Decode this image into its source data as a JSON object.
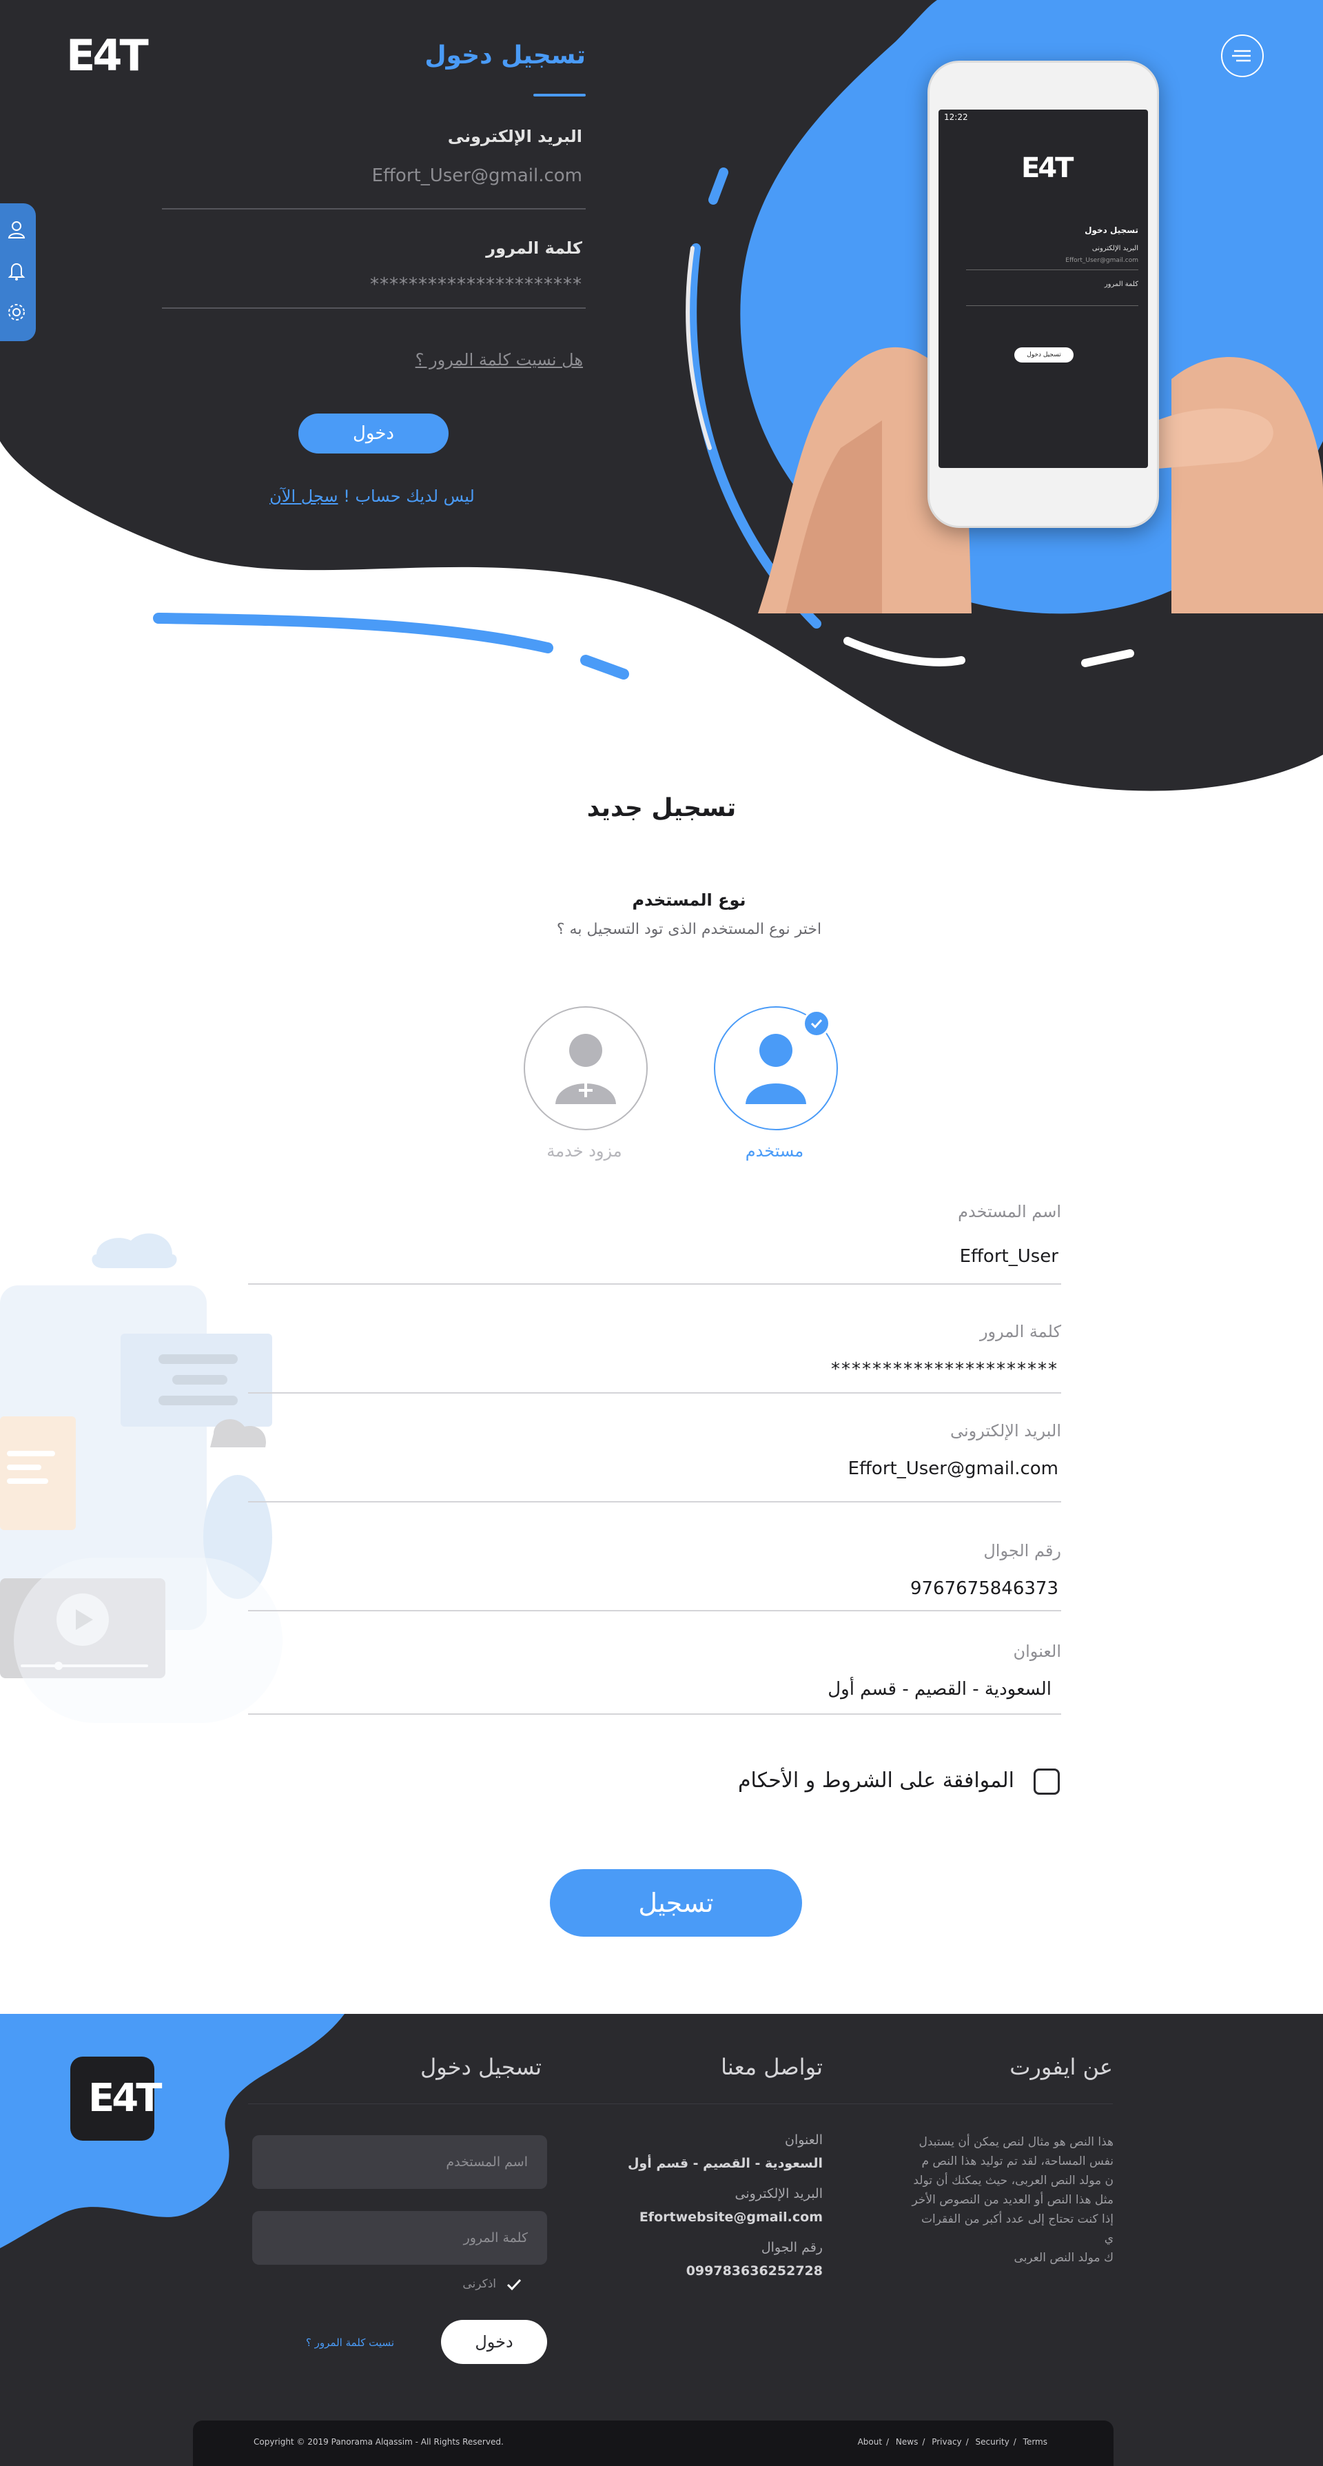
{
  "brand": {
    "logo_text": "E4T"
  },
  "login": {
    "title": "تسجيل دخول",
    "email_label": "البريد الإلكترونى",
    "email_value": "Effort_User@gmail.com",
    "password_label": "كلمة المرور",
    "password_value": "**********************",
    "forgot": "هل نسيت كلمة المرور ؟",
    "button": "دخول",
    "no_account": "ليس لديك حساب !",
    "register_now": "سجل الآن"
  },
  "phone_mock": {
    "time": "12:22",
    "title": "تسجيل دخول",
    "email_label": "البريد الإلكترونى",
    "email_value": "Effort_User@gmail.com",
    "password_label": "كلمة المرور",
    "button": "تسجيل دخول"
  },
  "register": {
    "title": "تسجيل جديد",
    "user_type_title": "نوع المستخدم",
    "user_type_sub": "اختر نوع المستخدم الذى تود التسجيل به ؟",
    "types": [
      {
        "label": "مستخدم",
        "selected": true
      },
      {
        "label": "مزود خدمة",
        "selected": false
      }
    ],
    "fields": [
      {
        "label": "اسم المستخدم",
        "value": "Effort_User"
      },
      {
        "label": "كلمة المرور",
        "value": "**********************"
      },
      {
        "label": "البريد الإلكترونى",
        "value": "Effort_User@gmail.com"
      },
      {
        "label": "رقم الجوال",
        "value": "9767675846373"
      },
      {
        "label": "العنوان",
        "value": "السعودية - القصيم - قسم أول"
      }
    ],
    "terms": "الموافقة على الشروط و الأحكام",
    "submit": "تسجيل"
  },
  "footer": {
    "about_title": "عن ايفورت",
    "about_text": [
      "هذا النص هو مثال لنص يمكن أن يستبدل",
      "نفس المساحة، لقد تم توليد هذا النص م",
      "ن مولد النص العربى، حيث يمكنك أن تولد",
      "مثل هذا النص أو العديد من النصوص الأخر",
      "إذا كنت تحتاج إلى عدد أكبر من الفقرات ي",
      "ك مولد النص العربى"
    ],
    "contact_title": "تواصل معنا",
    "address_label": "العنوان",
    "address_value": "السعودية - القصيم - قسم أول",
    "email_label": "البريد الإلكترونى",
    "email_value": "Efortwebsite@gmail.com",
    "phone_label": "رقم الجوال",
    "phone_value": "099783636252728",
    "login_title": "تسجيل دخول",
    "username_placeholder": "اسم المستخدم",
    "password_placeholder": "كلمة المرور",
    "remember": "اذكرنى",
    "login_button": "دخول",
    "forgot": "نسيت كلمة المرور ؟",
    "copyright": "Copyright © 2019 Panorama Alqassim - All Rights Reserved.",
    "links": [
      "About",
      "News",
      "Privacy",
      "Security",
      "Terms"
    ]
  },
  "colors": {
    "accent": "#4a9bf7",
    "dark": "#2a2a2e",
    "darker": "#151518"
  }
}
